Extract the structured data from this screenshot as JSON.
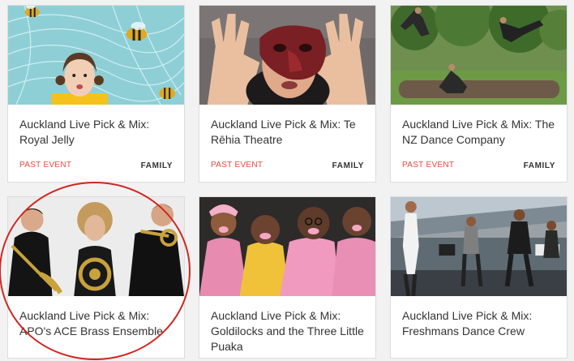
{
  "cards": [
    {
      "title": "Auckland Live Pick & Mix: Royal Jelly",
      "status": "PAST EVENT",
      "category": "FAMILY",
      "image": "illustration with bees and girl on blue background"
    },
    {
      "title": "Auckland Live Pick & Mix: Te Rēhia Theatre",
      "status": "PAST EVENT",
      "category": "FAMILY",
      "image": "performer wearing red mask with raised hands"
    },
    {
      "title": "Auckland Live Pick & Mix: The NZ Dance Company",
      "status": "PAST EVENT",
      "category": "FAMILY",
      "image": "dancers leaping in park over log"
    },
    {
      "title": "Auckland Live Pick & Mix: APO's ACE Brass Ensemble",
      "status": "",
      "category": "",
      "image": "brass musicians with trombone horn and trumpet"
    },
    {
      "title": "Auckland Live Pick & Mix: Goldilocks and the Three Little Puaka",
      "status": "",
      "category": "",
      "image": "performers in pink costumes with pig noses"
    },
    {
      "title": "Auckland Live Pick & Mix: Freshmans Dance Crew",
      "status": "",
      "category": "",
      "image": "street dance crew performing outdoors"
    }
  ],
  "colors": {
    "status": "#e64a3b",
    "annotation_circle": "#d0261f"
  }
}
